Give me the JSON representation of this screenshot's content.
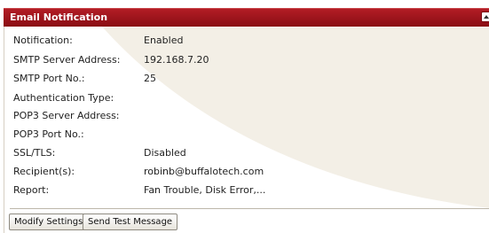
{
  "panel": {
    "title": "Email Notification"
  },
  "fields": [
    {
      "label": "Notification:",
      "value": "Enabled"
    },
    {
      "label": "SMTP Server Address:",
      "value": "192.168.7.20"
    },
    {
      "label": "SMTP Port No.:",
      "value": "25"
    },
    {
      "label": "Authentication Type:",
      "value": ""
    },
    {
      "label": "POP3 Server Address:",
      "value": ""
    },
    {
      "label": "POP3 Port No.:",
      "value": ""
    },
    {
      "label": "SSL/TLS:",
      "value": "Disabled"
    },
    {
      "label": "Recipient(s):",
      "value": "robinb@buffalotech.com"
    },
    {
      "label": "Report:",
      "value": "Fan Trouble, Disk Error,..."
    }
  ],
  "buttons": {
    "modify": "Modify Settings",
    "test": "Send Test Message"
  },
  "icons": {
    "collapse": "collapse-up-icon"
  },
  "colors": {
    "header": "#9b111a",
    "background_swoosh": "#f3efe6"
  }
}
